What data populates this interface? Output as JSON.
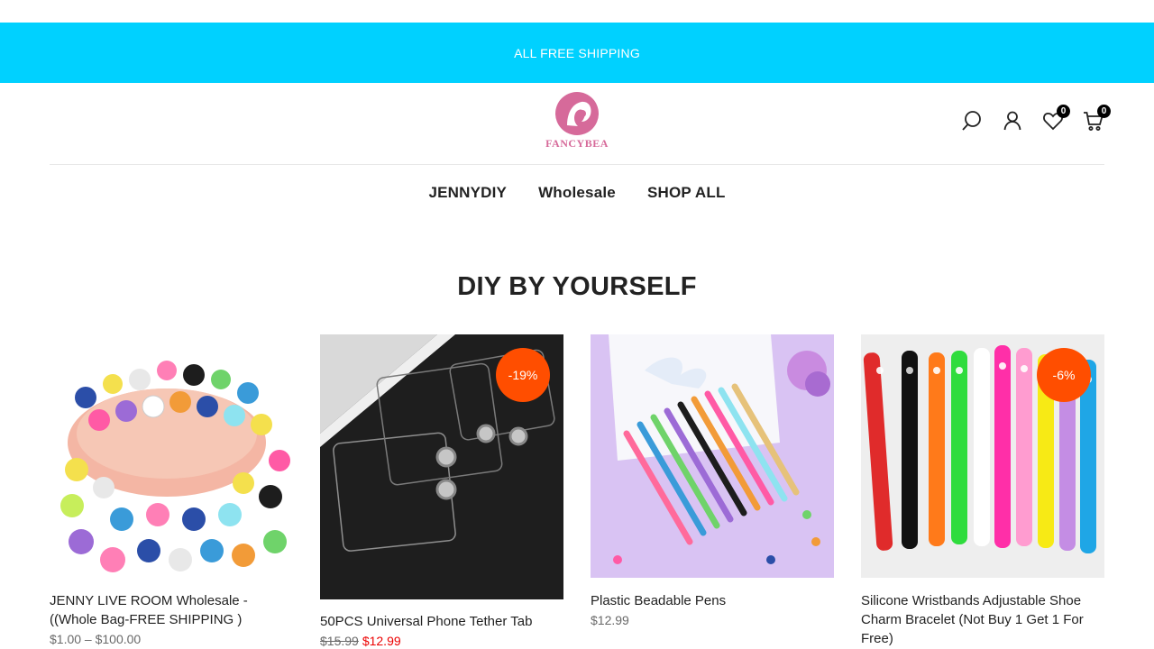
{
  "announcement": {
    "text": "ALL FREE SHIPPING"
  },
  "header": {
    "logo_text": "FANCYBEA",
    "wishlist_count": "0",
    "cart_count": "0"
  },
  "nav": {
    "items": [
      {
        "label": "JENNYDIY"
      },
      {
        "label": "Wholesale"
      },
      {
        "label": "SHOP ALL"
      }
    ]
  },
  "section": {
    "title": "DIY BY YOURSELF"
  },
  "products": [
    {
      "title": "JENNY LIVE ROOM Wholesale -((Whole Bag-FREE SHIPPING )",
      "price": "$1.00 – $100.00",
      "old_price": "",
      "new_price": "",
      "badge": ""
    },
    {
      "title": "50PCS Universal Phone Tether Tab",
      "price": "",
      "old_price": "$15.99",
      "new_price": "$12.99",
      "badge": "-19%"
    },
    {
      "title": "Plastic Beadable Pens",
      "price": "$12.99",
      "old_price": "",
      "new_price": "",
      "badge": ""
    },
    {
      "title": "Silicone Wristbands Adjustable Shoe Charm Bracelet (Not Buy 1 Get 1 For Free)",
      "price": "",
      "old_price": "",
      "new_price": "",
      "badge": "-6%"
    }
  ],
  "colors": {
    "announcement_bg": "#00d1ff",
    "badge_bg": "#ff4e00",
    "sale_price": "#ec0101",
    "logo": "#d66a9a"
  },
  "icons": [
    "search-icon",
    "user-icon",
    "heart-icon",
    "cart-icon"
  ]
}
